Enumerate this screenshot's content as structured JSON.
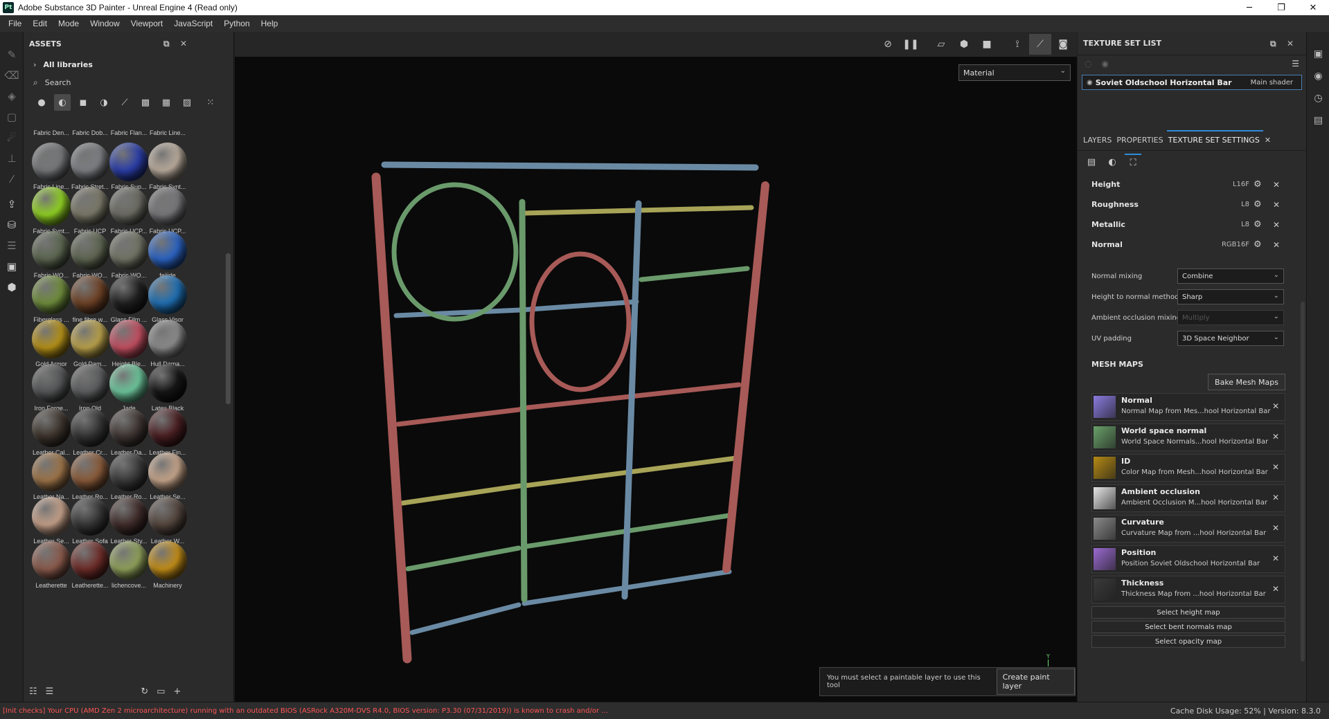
{
  "window": {
    "app_icon": "Pt",
    "title": "Adobe Substance 3D Painter - Unreal Engine 4 (Read only)",
    "controls": [
      "─",
      "❐",
      "✕"
    ]
  },
  "menu": [
    "File",
    "Edit",
    "Mode",
    "Window",
    "Viewport",
    "JavaScript",
    "Python",
    "Help"
  ],
  "assets": {
    "title": "ASSETS",
    "libraries_label": "All libraries",
    "search_placeholder": "Search",
    "items": [
      {
        "label": "Fabric Den...",
        "color": "#55585a",
        "partial": true
      },
      {
        "label": "Fabric Dob...",
        "color": "#6a6a62",
        "partial": true
      },
      {
        "label": "Fabric Flan...",
        "color": "#5a2a28",
        "partial": true
      },
      {
        "label": "Fabric Line...",
        "color": "#8a8a8a",
        "partial": true
      },
      {
        "label": "Fabric Line...",
        "color": "#75777a"
      },
      {
        "label": "Fabric Stret...",
        "color": "#7c7e82"
      },
      {
        "label": "Fabric Sup...",
        "color": "#2b3ea8"
      },
      {
        "label": "Fabric Synt...",
        "color": "#b9ab9c"
      },
      {
        "label": "Fabric Synt...",
        "color": "#8fd023"
      },
      {
        "label": "Fabric UCP",
        "color": "#7a7868"
      },
      {
        "label": "Fabric UCP...",
        "color": "#6c6c64"
      },
      {
        "label": "Fabric UCP...",
        "color": "#77777a"
      },
      {
        "label": "Fabric WO...",
        "color": "#5b6650"
      },
      {
        "label": "Fabric WO...",
        "color": "#5f6652"
      },
      {
        "label": "Fabric WO...",
        "color": "#727466"
      },
      {
        "label": "feijide",
        "color": "#2b63c2"
      },
      {
        "label": "Fiberglass ...",
        "color": "#6e8c3c"
      },
      {
        "label": "fine fibre w...",
        "color": "#6e4226"
      },
      {
        "label": "Glass Film ...",
        "color": "#202020"
      },
      {
        "label": "Glass Visor",
        "color": "#1f6fb3"
      },
      {
        "label": "Gold Armor",
        "color": "#b49018"
      },
      {
        "label": "Gold Dam...",
        "color": "#b8a04a"
      },
      {
        "label": "Height Ble...",
        "color": "#c24f61"
      },
      {
        "label": "Hull Dama...",
        "color": "#8a8a8a"
      },
      {
        "label": "Iron Forge...",
        "color": "#555657"
      },
      {
        "label": "Iron Old",
        "color": "#5c5d5e"
      },
      {
        "label": "Jade",
        "color": "#6cc59b"
      },
      {
        "label": "Latex Black",
        "color": "#161616"
      },
      {
        "label": "Leather Cal...",
        "color": "#3d342c"
      },
      {
        "label": "Leather Cr...",
        "color": "#353535"
      },
      {
        "label": "Leather Da...",
        "color": "#3f3633"
      },
      {
        "label": "Leather Fin...",
        "color": "#4a1f22"
      },
      {
        "label": "Leather Na...",
        "color": "#9c7348"
      },
      {
        "label": "Leather Ro...",
        "color": "#8a5b3a"
      },
      {
        "label": "Leather Ro...",
        "color": "#3a3a3a"
      },
      {
        "label": "Leather Se...",
        "color": "#c5a48a"
      },
      {
        "label": "Leather Se...",
        "color": "#c39f88"
      },
      {
        "label": "Leather Sofa",
        "color": "#363636"
      },
      {
        "label": "Leather Sty...",
        "color": "#3f2c2a"
      },
      {
        "label": "Leather W...",
        "color": "#54463e"
      },
      {
        "label": "Leatherette",
        "color": "#8a5a4c"
      },
      {
        "label": "Leatherette...",
        "color": "#6e2d29"
      },
      {
        "label": "lichencove...",
        "color": "#8fa05a"
      },
      {
        "label": "Machinery",
        "color": "#c28d18"
      }
    ]
  },
  "viewport": {
    "material_select": "Material",
    "notice_message": "You must select a paintable layer to use this tool",
    "notice_button": "Create paint layer",
    "axis_label": "Y",
    "bar_colors": {
      "red": "#a75a57",
      "blue": "#6a8aa4",
      "green": "#6a9a6b",
      "yellow": "#a7a458"
    }
  },
  "texture_set_list": {
    "title": "TEXTURE SET LIST",
    "item_name": "Soviet Oldschool Horizontal Bar",
    "item_shader": "Main shader"
  },
  "tabs": {
    "layers": "LAYERS",
    "properties": "PROPERTIES",
    "texture_set_settings": "TEXTURE SET SETTINGS"
  },
  "channels": [
    {
      "name": "Height",
      "format": "L16F"
    },
    {
      "name": "Roughness",
      "format": "L8"
    },
    {
      "name": "Metallic",
      "format": "L8"
    },
    {
      "name": "Normal",
      "format": "RGB16F"
    }
  ],
  "settings": [
    {
      "label": "Normal mixing",
      "value": "Combine",
      "disabled": false
    },
    {
      "label": "Height to normal method",
      "value": "Sharp",
      "disabled": false
    },
    {
      "label": "Ambient occlusion mixing",
      "value": "Multiply",
      "disabled": true
    },
    {
      "label": "UV padding",
      "value": "3D Space Neighbor",
      "disabled": false
    }
  ],
  "mesh_maps": {
    "title": "MESH MAPS",
    "bake_button": "Bake Mesh Maps",
    "items": [
      {
        "name": "Normal",
        "desc": "Normal Map from Mes...hool Horizontal Bar",
        "color": "#8a7be0"
      },
      {
        "name": "World space normal",
        "desc": "World Space Normals...hool Horizontal Bar",
        "color": "#6aa06a"
      },
      {
        "name": "ID",
        "desc": "Color Map from Mesh...hool Horizontal Bar",
        "color": "#b58a14"
      },
      {
        "name": "Ambient occlusion",
        "desc": "Ambient Occlusion M...hool Horizontal Bar",
        "color": "#e6e6e6"
      },
      {
        "name": "Curvature",
        "desc": "Curvature Map from ...hool Horizontal Bar",
        "color": "#8a8a8a"
      },
      {
        "name": "Position",
        "desc": "Position Soviet Oldschool Horizontal Bar",
        "color": "#9a6ad0"
      },
      {
        "name": "Thickness",
        "desc": "Thickness Map from ...hool Horizontal Bar",
        "color": "#3a3a3a"
      }
    ],
    "select_buttons": [
      "Select height map",
      "Select bent normals map",
      "Select opacity map"
    ]
  },
  "status": {
    "warning": "[Init checks] Your CPU (AMD Zen 2 microarchitecture) running with an outdated BIOS (ASRock A320M-DVS R4.0, BIOS version: P3.30 (07/31/2019)) is known to crash and/or ...",
    "cache": "Cache Disk Usage:   52% | Version: 8.3.0",
    "warning_color": "#ff5555"
  }
}
